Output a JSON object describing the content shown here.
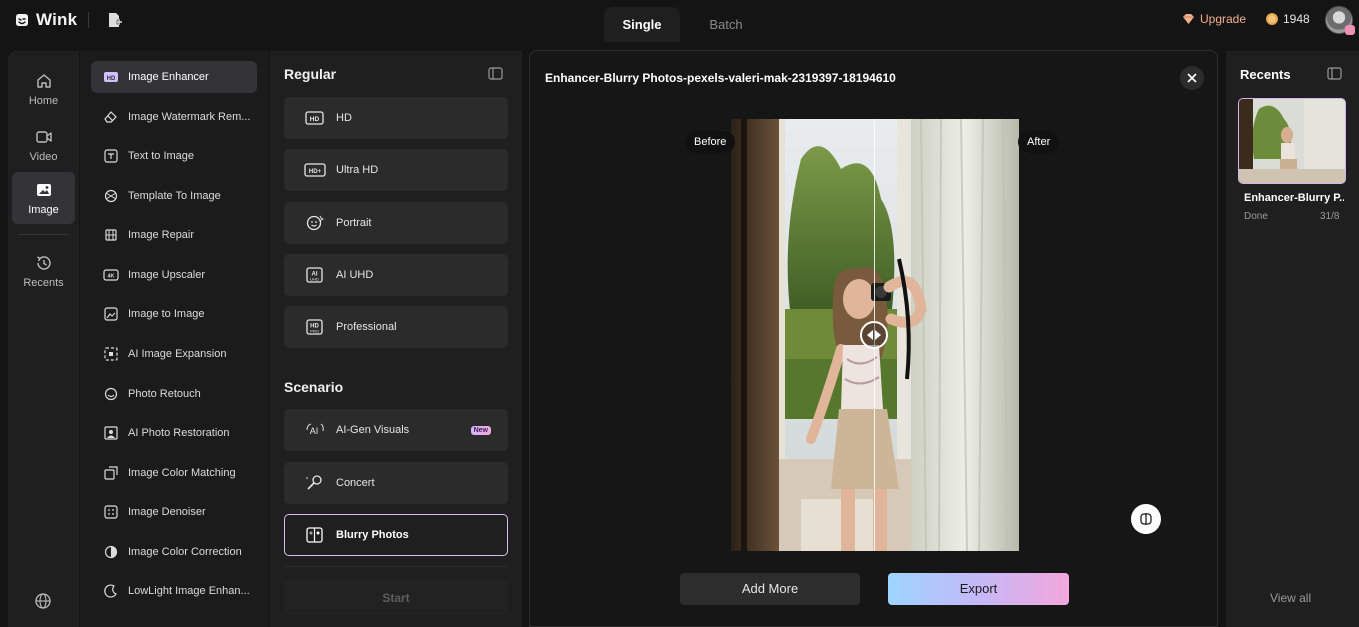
{
  "app": {
    "name": "Wink",
    "modes": [
      "Single",
      "Batch"
    ],
    "active_mode": "Single",
    "upgrade_label": "Upgrade",
    "credits": "1948",
    "accent_gradient": [
      "#9ed5ff",
      "#c5b8f7",
      "#f3a7dc"
    ]
  },
  "nav": {
    "items": [
      {
        "label": "Home",
        "icon": "home-icon"
      },
      {
        "label": "Video",
        "icon": "video-icon"
      },
      {
        "label": "Image",
        "icon": "image-icon",
        "active": true
      },
      {
        "label": "Recents",
        "icon": "history-icon"
      }
    ],
    "footer_icon": "globe-icon"
  },
  "tools": {
    "items": [
      {
        "label": "Image Enhancer",
        "icon": "hd-icon",
        "active": true
      },
      {
        "label": "Image Watermark Rem...",
        "icon": "eraser-icon"
      },
      {
        "label": "Text to Image",
        "icon": "text-image-icon"
      },
      {
        "label": "Template To Image",
        "icon": "template-icon"
      },
      {
        "label": "Image Repair",
        "icon": "repair-icon"
      },
      {
        "label": "Image Upscaler",
        "icon": "4k-icon"
      },
      {
        "label": "Image to Image",
        "icon": "image-to-image-icon"
      },
      {
        "label": "AI Image Expansion",
        "icon": "expand-icon"
      },
      {
        "label": "Photo Retouch",
        "icon": "retouch-icon"
      },
      {
        "label": "AI Photo Restoration",
        "icon": "restoration-icon"
      },
      {
        "label": "Image Color Matching",
        "icon": "color-match-icon"
      },
      {
        "label": "Image Denoiser",
        "icon": "denoise-icon"
      },
      {
        "label": "Image Color Correction",
        "icon": "color-correction-icon"
      },
      {
        "label": "LowLight Image Enhan...",
        "icon": "lowlight-icon"
      }
    ]
  },
  "options": {
    "regular_heading": "Regular",
    "regular": [
      {
        "label": "HD",
        "icon": "hd-icon"
      },
      {
        "label": "Ultra HD",
        "icon": "hd-plus-icon"
      },
      {
        "label": "Portrait",
        "icon": "face-icon"
      },
      {
        "label": "AI UHD",
        "icon": "ai-uhd-icon"
      },
      {
        "label": "Professional",
        "icon": "hd-pro-icon"
      }
    ],
    "scenario_heading": "Scenario",
    "scenario": [
      {
        "label": "AI-Gen Visuals",
        "icon": "ai-sparkle-icon",
        "badge": "New"
      },
      {
        "label": "Concert",
        "icon": "concert-icon"
      },
      {
        "label": "Blurry Photos",
        "icon": "blurry-photo-icon",
        "selected": true
      }
    ],
    "start_label": "Start"
  },
  "preview": {
    "title": "Enhancer-Blurry Photos-pexels-valeri-mak-2319397-18194610",
    "before_label": "Before",
    "after_label": "After",
    "add_more_label": "Add More",
    "export_label": "Export",
    "compare_icon": "compare-icon",
    "close_icon": "close-icon"
  },
  "recents": {
    "title": "Recents",
    "items": [
      {
        "name": "Enhancer-Blurry P...",
        "status": "Done",
        "date": "31/8"
      }
    ],
    "view_all_label": "View all"
  }
}
